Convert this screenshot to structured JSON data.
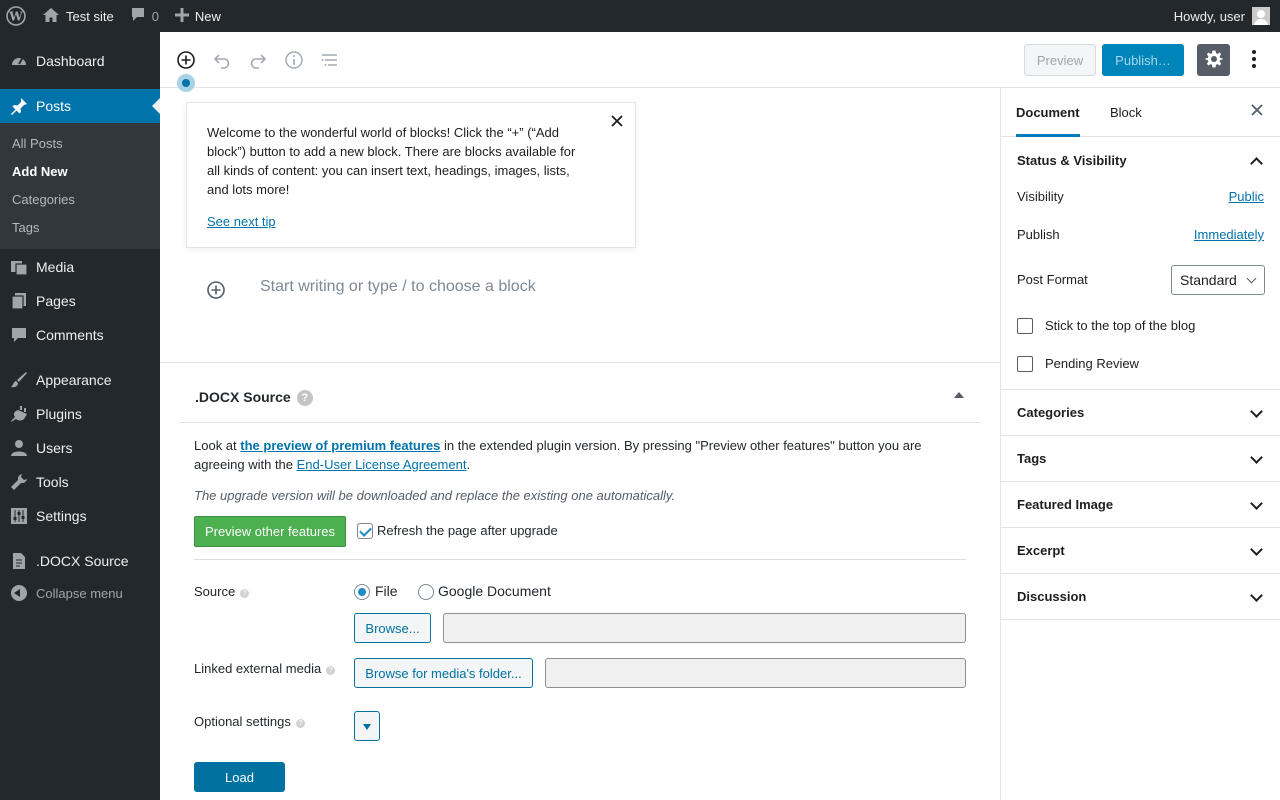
{
  "admin_bar": {
    "site_name": "Test site",
    "comments_count": "0",
    "new_label": "New",
    "greeting": "Howdy, user"
  },
  "menu": {
    "dashboard": "Dashboard",
    "posts": "Posts",
    "posts_sub": [
      "All Posts",
      "Add New",
      "Categories",
      "Tags"
    ],
    "media": "Media",
    "pages": "Pages",
    "comments": "Comments",
    "appearance": "Appearance",
    "plugins": "Plugins",
    "users": "Users",
    "tools": "Tools",
    "settings": "Settings",
    "docx_source": ".DOCX Source",
    "collapse": "Collapse menu"
  },
  "header": {
    "preview_label": "Preview",
    "publish_label": "Publish…"
  },
  "tip": {
    "text": "Welcome to the wonderful world of blocks! Click the “+” (“Add block”) button to add a new block. There are blocks available for all kinds of content: you can insert text, headings, images, lists, and lots more!",
    "next_link": "See next tip"
  },
  "editor": {
    "placeholder": "Start writing or type / to choose a block"
  },
  "docx_box": {
    "title": ".DOCX Source",
    "intro_prefix": "Look at ",
    "intro_link": "the preview of premium features",
    "intro_middle": " in the extended plugin version. By pressing \"Preview other features\" button you are agreeing with the ",
    "eula_link": "End-User License Agreement",
    "intro_suffix": ".",
    "upgrade_note": "The upgrade version will be downloaded and replace the existing one automatically.",
    "preview_features_btn": "Preview other features",
    "refresh_label": "Refresh the page after upgrade",
    "source_label": "Source",
    "source_options": [
      "File",
      "Google Document"
    ],
    "browse_btn": "Browse...",
    "linked_media_label": "Linked external media",
    "browse_media_btn": "Browse for media's folder...",
    "optional_label": "Optional settings",
    "load_btn": "Load"
  },
  "sidebar": {
    "tab_document": "Document",
    "tab_block": "Block",
    "status_title": "Status & Visibility",
    "visibility_label": "Visibility",
    "visibility_value": "Public",
    "publish_label": "Publish",
    "publish_value": "Immediately",
    "post_format_label": "Post Format",
    "post_format_value": "Standard",
    "stick_label": "Stick to the top of the blog",
    "pending_label": "Pending Review",
    "panels": [
      "Categories",
      "Tags",
      "Featured Image",
      "Excerpt",
      "Discussion"
    ]
  },
  "colors": {
    "admin_dark": "#23282d",
    "accent_blue": "#0073aa",
    "green_button": "#4caf50"
  }
}
